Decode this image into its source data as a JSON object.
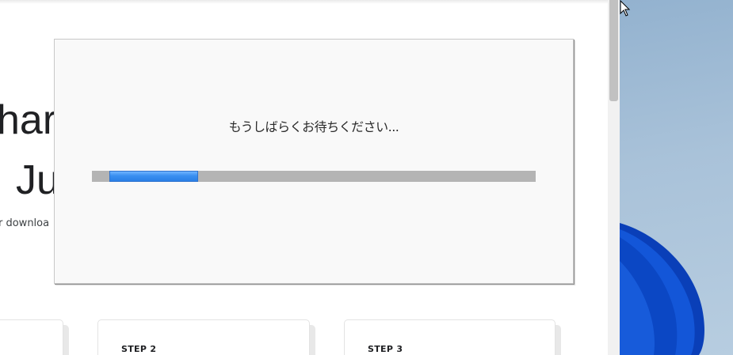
{
  "page": {
    "hero_line1": "har",
    "hero_line2": "Ju",
    "hero_subtext": "r downloa",
    "steps": [
      {
        "label": ""
      },
      {
        "label": "STEP 2"
      },
      {
        "label": "STEP 3"
      }
    ]
  },
  "dialog": {
    "message": "もうしばらくお待ちください...",
    "progress": {
      "style": "marquee",
      "chunk_start": 0.04,
      "chunk_end": 0.24,
      "track_color": "#b4b4b4",
      "chunk_color": "#3a8ff0"
    }
  },
  "desktop": {
    "wallpaper_color": "#a9c2d9",
    "bloom_color": "#0d49c9"
  }
}
